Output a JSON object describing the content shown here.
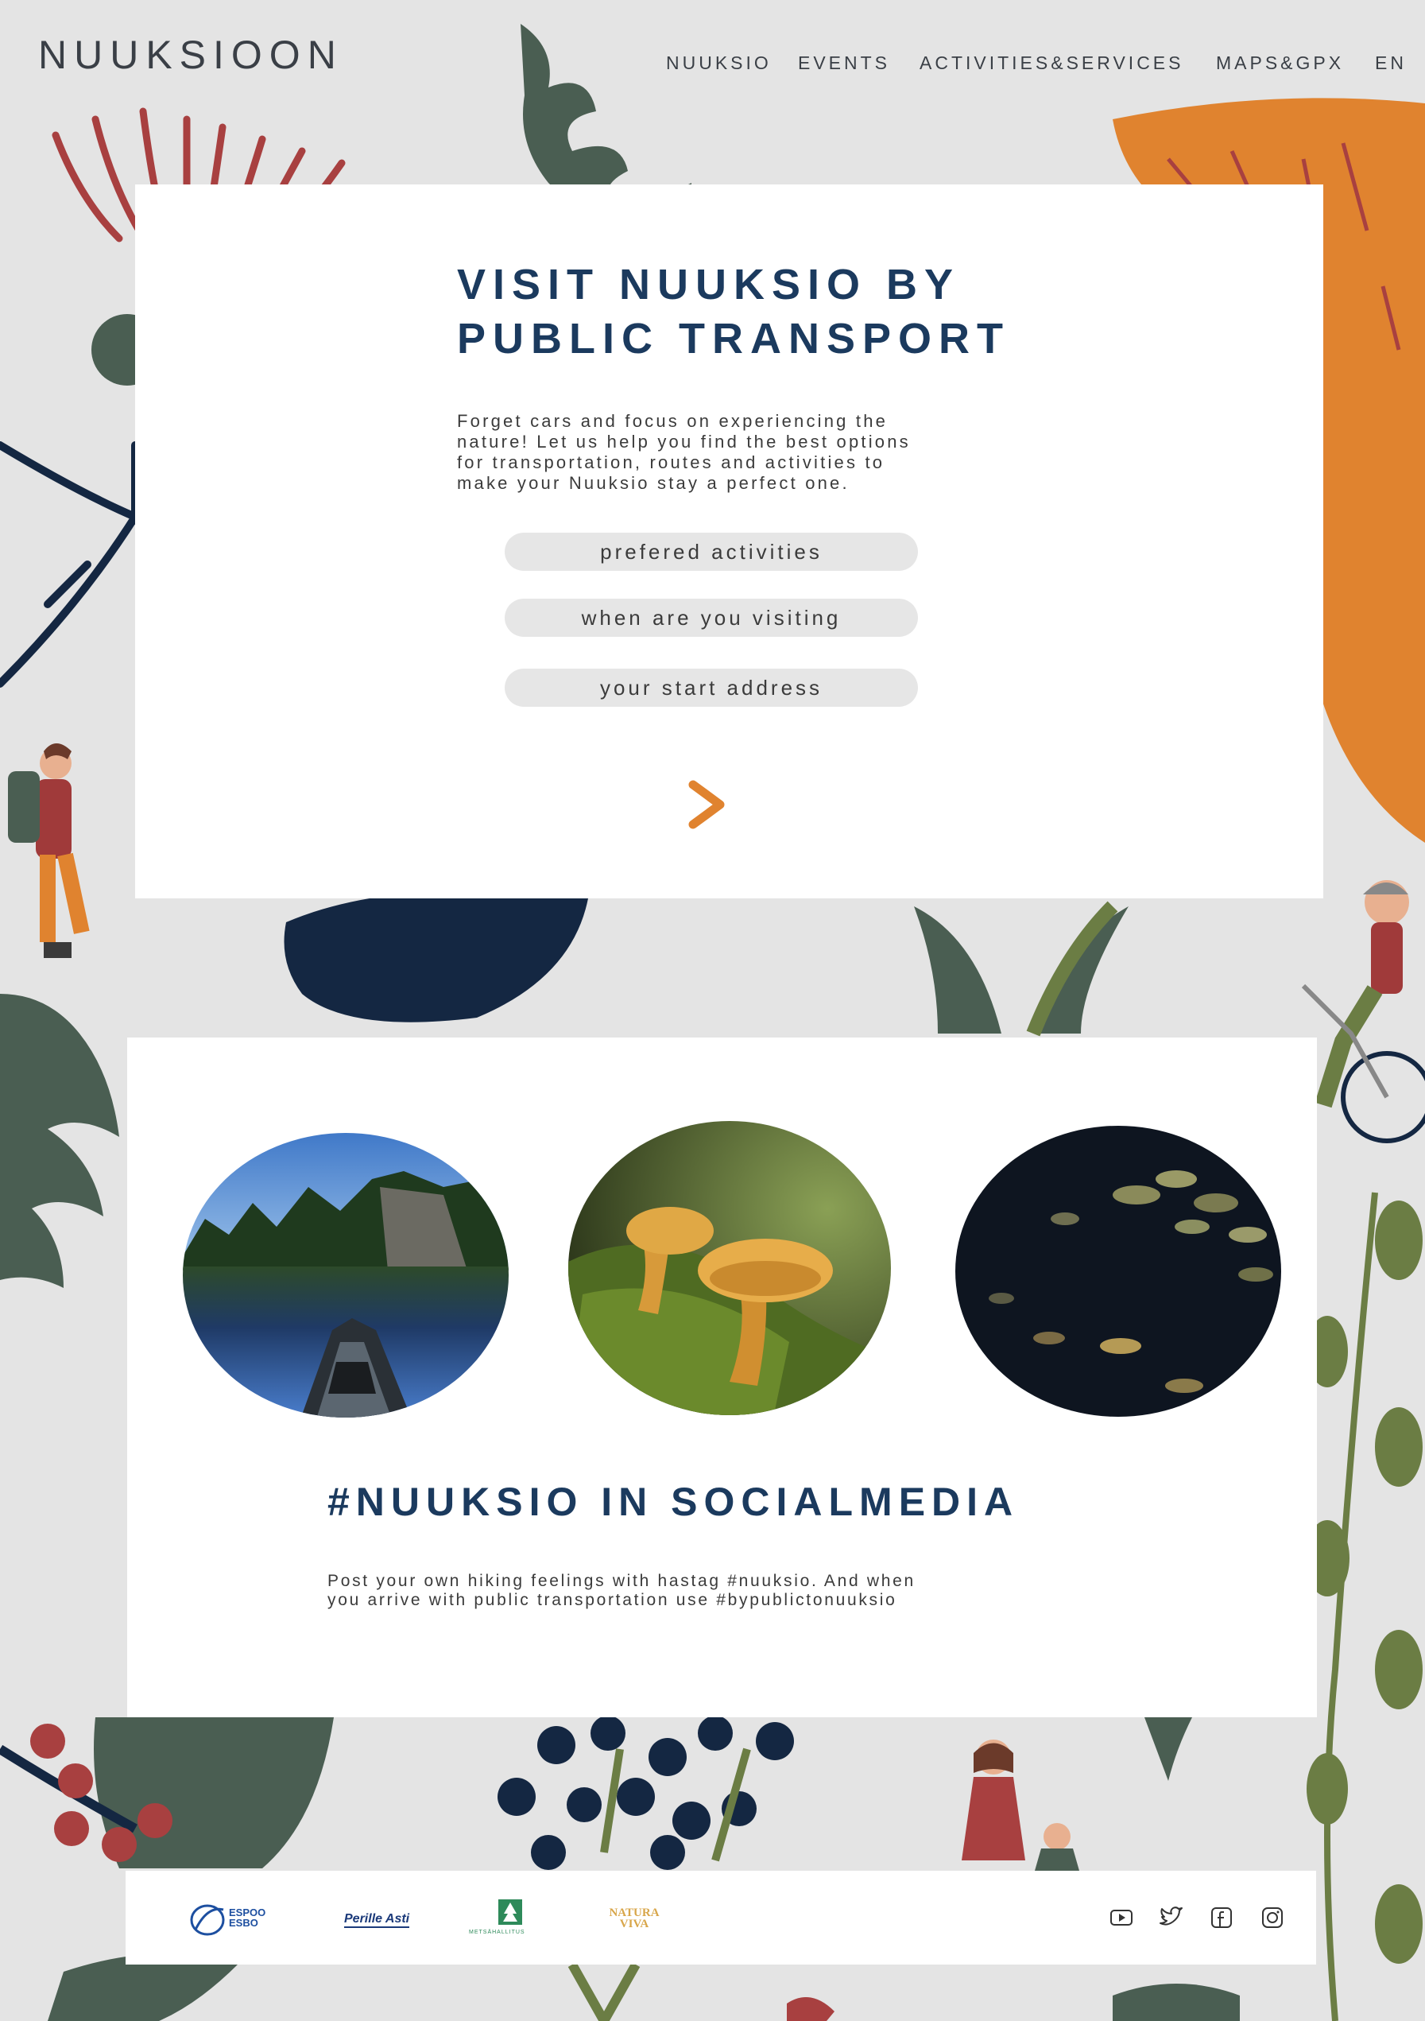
{
  "header": {
    "site_title": "NUUKSIOON",
    "nav": [
      {
        "label": "NUUKSIO"
      },
      {
        "label": "EVENTS"
      },
      {
        "label": "ACTIVITIES&SERVICES"
      },
      {
        "label": "MAPS&GPX"
      },
      {
        "label": "EN"
      }
    ]
  },
  "hero": {
    "title_line1": "VISIT NUUKSIO BY",
    "title_line2": "PUBLIC TRANSPORT",
    "text_lines": [
      "Forget cars and focus on experiencing the",
      "nature! Let us help you find the best options",
      "for transportation, routes and activities to",
      "make your Nuuksio stay a perfect one."
    ],
    "fields": [
      {
        "label": "prefered activities"
      },
      {
        "label": "when are you visiting"
      },
      {
        "label": "your start address"
      }
    ],
    "next_icon": "chevron-right-icon"
  },
  "social": {
    "title": "#NUUKSIO IN SOCIALMEDIA",
    "text_lines": [
      "Post your own hiking feelings with hastag #nuuksio. And when",
      "you arrive with public transportation use #bypublictonuuksio"
    ],
    "photos": [
      "lake-canoe-photo",
      "chanterelle-mushrooms-photo",
      "water-lilies-photo"
    ]
  },
  "footer": {
    "logos": [
      {
        "line1": "ESPOO",
        "line2": "ESBO"
      },
      {
        "text": "Perille Asti"
      },
      {
        "text": "METSÄHALLITUS"
      },
      {
        "line1": "NATURA",
        "line2": "VIVA"
      }
    ],
    "social_icons": [
      "youtube-icon",
      "twitter-icon",
      "facebook-icon",
      "instagram-icon"
    ]
  },
  "colors": {
    "background": "#e4e4e4",
    "title_blue": "#1b3a5e",
    "accent_orange": "#e0832f",
    "leaf_green": "#4a5e52",
    "olive": "#6b7d44",
    "berry_red": "#a84040",
    "navy": "#142742"
  }
}
